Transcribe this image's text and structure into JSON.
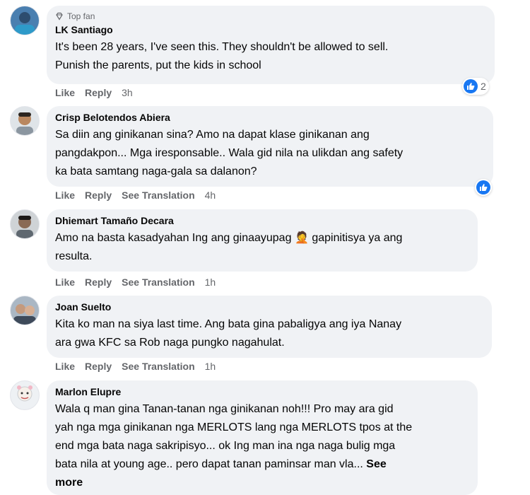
{
  "comments": [
    {
      "top_fan": "Top fan",
      "name": "LK Santiago",
      "lines": [
        "It's been 28 years, I've seen this. They shouldn't be allowed to sell.",
        "Punish the parents, put the kids in school"
      ],
      "like": "Like",
      "reply": "Reply",
      "time": "3h",
      "reaction_count": "2",
      "avatar_color": "#4a7fb0"
    },
    {
      "name": "Crisp Belotendos Abiera",
      "lines": [
        "Sa diin ang ginikanan sina? Amo na dapat klase ginikanan ang",
        "pangdakpon... Mga iresponsable.. Wala gid nila na ulikdan ang safety",
        "ka bata samtang naga-gala sa dalanon?"
      ],
      "like": "Like",
      "reply": "Reply",
      "translate": "See Translation",
      "time": "4h",
      "avatar_color": "#c9a98a"
    },
    {
      "name": "Dhiemart Tamaño Decara",
      "line1_a": "Amo na basta kasadyahan Ing ang ginaayupag",
      "emoji": "🤦",
      "line1_b": "gapinitisya ya ang",
      "line2": "resulta.",
      "like": "Like",
      "reply": "Reply",
      "translate": "See Translation",
      "time": "1h",
      "avatar_color": "#8a7f78"
    },
    {
      "name": "Joan Suelto",
      "lines": [
        "Kita ko man na siya last time. Ang bata gina pabaligya ang iya Nanay",
        "ara gwa KFC sa Rob naga pungko nagahulat."
      ],
      "like": "Like",
      "reply": "Reply",
      "translate": "See Translation",
      "time": "1h",
      "avatar_color": "#6f8aa8"
    },
    {
      "name": "Marlon Elupre",
      "lines": [
        "Wala q man gina Tanan-tanan nga ginikanan noh!!! Pro may ara gid",
        "yah nga mga ginikanan nga MERLOTS lang nga MERLOTS tpos at the",
        "end mga bata naga sakripisyo... ok Ing man ina nga naga bulig mga",
        "bata nila at young age.. pero dapat tanan paminsar man vla..."
      ],
      "see_more_a": "See",
      "see_more_b": "more",
      "avatar_color": "#e9eef2"
    }
  ],
  "colors": {
    "bubble": "#f0f2f5",
    "meta": "#65676b",
    "like_blue": "#1877f2"
  }
}
